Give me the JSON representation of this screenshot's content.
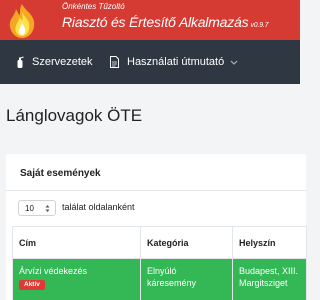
{
  "header": {
    "subtitle": "Önkéntes Tűzoltó",
    "title": "Riasztó és Értesítő Alkalmazás",
    "version": "v0.9.7",
    "background_color": "#d53b33",
    "logo_icon": "flame-logo"
  },
  "nav": {
    "background_color": "#2f3743",
    "items": [
      {
        "label": "Szervezetek",
        "icon": "fire-extinguisher-icon"
      },
      {
        "label": "Használati útmutató",
        "icon": "document-icon"
      }
    ]
  },
  "page": {
    "title": "Lánglovagok ÖTE"
  },
  "card": {
    "title": "Saját események",
    "page_size": "10",
    "page_size_suffix": "találat oldalanként",
    "columns": [
      "Cím",
      "Kategória",
      "Helyszín"
    ],
    "rows": [
      {
        "title": "Árvízi védekezés",
        "status": "Aktív",
        "category": "Elnyúló káresemény",
        "location": "Budapest, XIII. Margitsziget",
        "row_color": "#34b856",
        "status_color": "#e03a36"
      }
    ]
  }
}
